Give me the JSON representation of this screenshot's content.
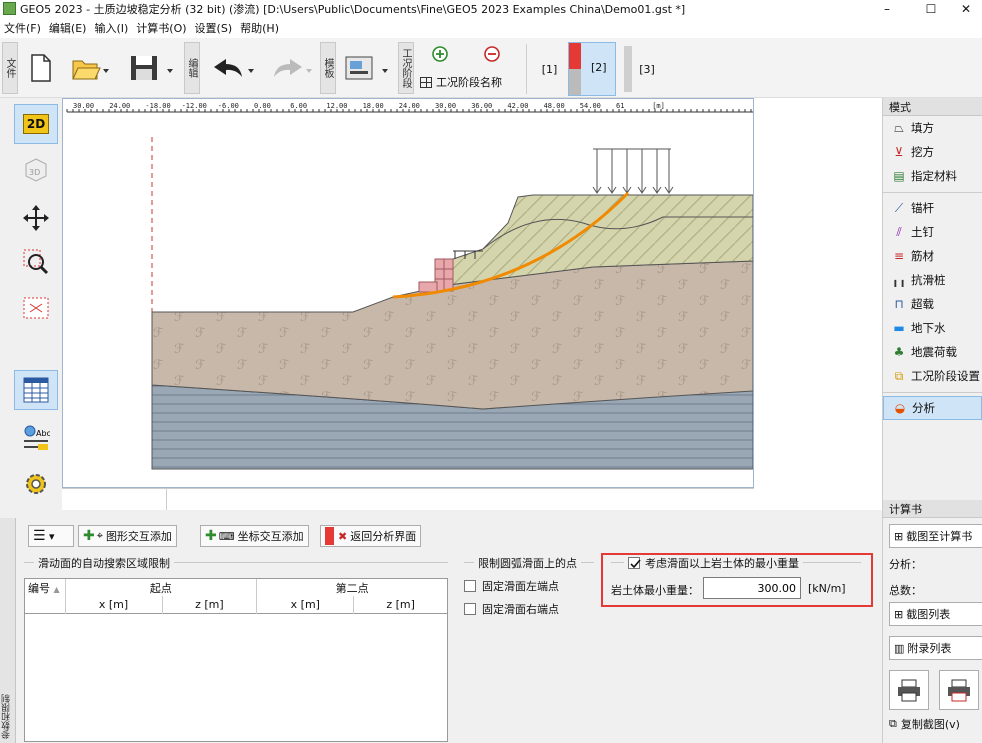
{
  "window": {
    "title": "GEO5 2023 - 土质边坡稳定分析 (32 bit) (渗流) [D:\\Users\\Public\\Documents\\Fine\\GEO5 2023 Examples China\\Demo01.gst *]",
    "minimize": "–",
    "maximize": "☐",
    "close": "✕"
  },
  "menu": [
    "文件(F)",
    "编辑(E)",
    "输入(I)",
    "计算书(O)",
    "设置(S)",
    "帮助(H)"
  ],
  "toolbar": {
    "file_label": "文件",
    "edit_label": "编辑",
    "template_label": "模板",
    "stage_label": "工况阶段",
    "stage_name_label": "工况阶段名称",
    "stages": [
      "[1]",
      "[2]",
      "[3]"
    ]
  },
  "ruler": {
    "ticks": [
      "30.00",
      "24.00",
      "-18.00",
      "-12.00",
      "-6.00",
      "0.00",
      "6.00",
      "12.00",
      "18.00",
      "24.00",
      "30.00",
      "36.00",
      "42.00",
      "48.00",
      "54.00",
      "6​1",
      "[m]"
    ]
  },
  "left_tools": {
    "btn2d": "2D",
    "btn3d": "3D"
  },
  "right_panel": {
    "mode_header": "模式",
    "items": [
      "填方",
      "挖方",
      "指定材料",
      "锚杆",
      "土钉",
      "筋材",
      "抗滑桩",
      "超载",
      "地下水",
      "地震荷载",
      "工况阶段设置",
      "分析"
    ],
    "report_header": "计算书",
    "capture_btn": "截图至计算书",
    "analysis_label": "分析：",
    "total_label": "总数：",
    "capture_list": "截图列表",
    "appendix_list": "附录列表",
    "copy_view": "复制截图(v)"
  },
  "bottom": {
    "side_tab": "参数和限制",
    "btn_graphic_add": "图形交互添加",
    "btn_coord_add": "坐标交互添加",
    "btn_return": "返回分析界面",
    "section_search": "滑动面的自动搜索区域限制",
    "col_num": "编号",
    "col_start": "起点",
    "col_second": "第二点",
    "col_x": "x [m]",
    "col_z": "z [m]",
    "section_points": "限制圆弧滑面上的点",
    "fix_left": "固定滑面左端点",
    "fix_right": "固定滑面右端点",
    "consider_min": "考虑滑面以上岩土体的最小重量",
    "min_weight_label": "岩土体最小重量：",
    "min_weight_value": "300.00",
    "min_weight_unit": "[kN/m]"
  }
}
